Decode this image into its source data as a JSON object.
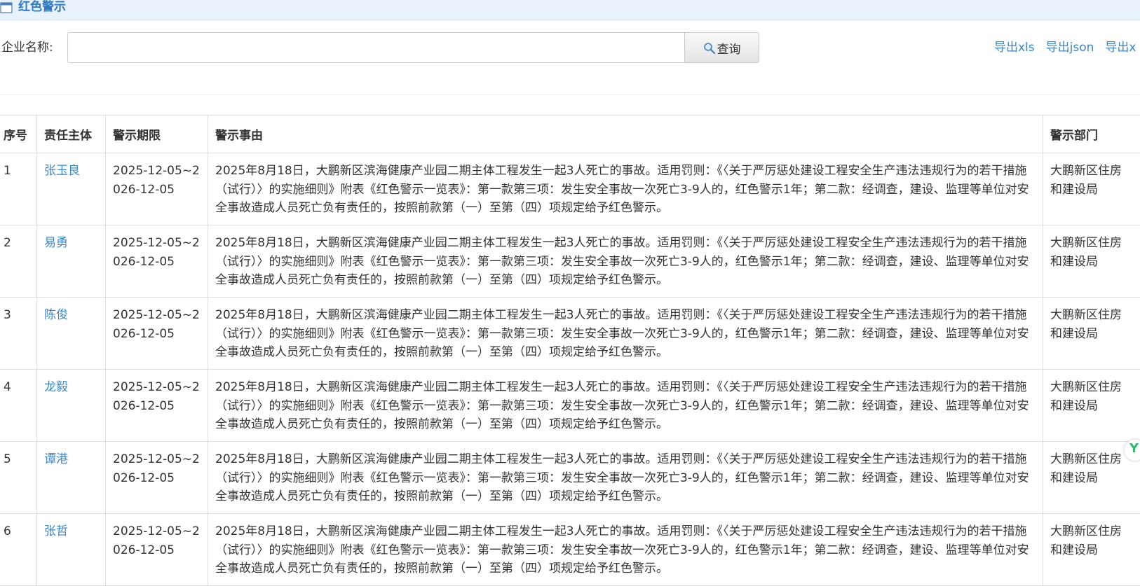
{
  "header": {
    "title": "红色警示"
  },
  "search": {
    "label": "企业名称:",
    "value": "",
    "placeholder": "",
    "button_label": "查询"
  },
  "exports": [
    "导出xls",
    "导出json",
    "导出x"
  ],
  "table": {
    "columns": [
      "序号",
      "责任主体",
      "警示期限",
      "警示事由",
      "警示部门"
    ],
    "rows": [
      {
        "no": "1",
        "subject": "张玉良",
        "period": "2025-12-05~2026-12-05",
        "reason": "2025年8月18日，大鹏新区滨海健康产业园二期主体工程发生一起3人死亡的事故。适用罚则：《〈关于严厉惩处建设工程安全生产违法违规行为的若干措施（试行）〉的实施细则》附表《红色警示一览表》：第一款第三项：发生安全事故一次死亡3-9人的，红色警示1年；第二款：经调查，建设、监理等单位对安全事故造成人员死亡负有责任的，按照前款第（一）至第（四）项规定给予红色警示。",
        "dept": "大鹏新区住房和建设局"
      },
      {
        "no": "2",
        "subject": "易勇",
        "period": "2025-12-05~2026-12-05",
        "reason": "2025年8月18日，大鹏新区滨海健康产业园二期主体工程发生一起3人死亡的事故。适用罚则：《〈关于严厉惩处建设工程安全生产违法违规行为的若干措施（试行）〉的实施细则》附表《红色警示一览表》：第一款第三项：发生安全事故一次死亡3-9人的，红色警示1年；第二款：经调查，建设、监理等单位对安全事故造成人员死亡负有责任的，按照前款第（一）至第（四）项规定给予红色警示。",
        "dept": "大鹏新区住房和建设局"
      },
      {
        "no": "3",
        "subject": "陈俊",
        "period": "2025-12-05~2026-12-05",
        "reason": "2025年8月18日，大鹏新区滨海健康产业园二期主体工程发生一起3人死亡的事故。适用罚则：《〈关于严厉惩处建设工程安全生产违法违规行为的若干措施（试行）〉的实施细则》附表《红色警示一览表》：第一款第三项：发生安全事故一次死亡3-9人的，红色警示1年；第二款：经调查，建设、监理等单位对安全事故造成人员死亡负有责任的，按照前款第（一）至第（四）项规定给予红色警示。",
        "dept": "大鹏新区住房和建设局"
      },
      {
        "no": "4",
        "subject": "龙毅",
        "period": "2025-12-05~2026-12-05",
        "reason": "2025年8月18日，大鹏新区滨海健康产业园二期主体工程发生一起3人死亡的事故。适用罚则：《〈关于严厉惩处建设工程安全生产违法违规行为的若干措施（试行）〉的实施细则》附表《红色警示一览表》：第一款第三项：发生安全事故一次死亡3-9人的，红色警示1年；第二款：经调查，建设、监理等单位对安全事故造成人员死亡负有责任的，按照前款第（一）至第（四）项规定给予红色警示。",
        "dept": "大鹏新区住房和建设局"
      },
      {
        "no": "5",
        "subject": "谭港",
        "period": "2025-12-05~2026-12-05",
        "reason": "2025年8月18日，大鹏新区滨海健康产业园二期主体工程发生一起3人死亡的事故。适用罚则：《〈关于严厉惩处建设工程安全生产违法违规行为的若干措施（试行）〉的实施细则》附表《红色警示一览表》：第一款第三项：发生安全事故一次死亡3-9人的，红色警示1年；第二款：经调查，建设、监理等单位对安全事故造成人员死亡负有责任的，按照前款第（一）至第（四）项规定给予红色警示。",
        "dept": "大鹏新区住房和建设局"
      },
      {
        "no": "6",
        "subject": "张哲",
        "period": "2025-12-05~2026-12-05",
        "reason": "2025年8月18日，大鹏新区滨海健康产业园二期主体工程发生一起3人死亡的事故。适用罚则：《〈关于严厉惩处建设工程安全生产违法违规行为的若干措施（试行）〉的实施细则》附表《红色警示一览表》：第一款第三项：发生安全事故一次死亡3-9人的，红色警示1年；第二款：经调查，建设、监理等单位对安全事故造成人员死亡负有责任的，按照前款第（一）至第（四）项规定给予红色警示。",
        "dept": "大鹏新区住房和建设局"
      }
    ]
  },
  "side_badge": {
    "glyph": "Y",
    "icon": "floating-app-icon"
  },
  "colors": {
    "link": "#3a87c8",
    "header_bg": "#e9f2fa",
    "header_title": "#2d7bc6",
    "badge": "#2dbb6f"
  }
}
